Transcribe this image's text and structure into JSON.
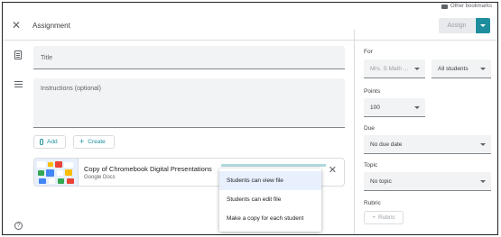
{
  "bookmarks": {
    "other_label": "Other bookmarks"
  },
  "header": {
    "title": "Assignment",
    "assign_label": "Assign"
  },
  "form": {
    "title_placeholder": "Title",
    "instructions_placeholder": "Instructions (optional)",
    "add_label": "Add",
    "create_label": "Create"
  },
  "attachment": {
    "title": "Copy of Chromebook Digital Presentations",
    "subtitle": "Google Docs"
  },
  "share_menu": {
    "items": [
      {
        "label": "Students can view file",
        "selected": true
      },
      {
        "label": "Students can edit file",
        "selected": false
      },
      {
        "label": "Make a copy for each student",
        "selected": false
      }
    ]
  },
  "sidebar": {
    "for_label": "For",
    "class_value": "Mrs. S Math ...",
    "students_value": "All students",
    "points_label": "Points",
    "points_value": "100",
    "due_label": "Due",
    "due_value": "No due date",
    "topic_label": "Topic",
    "topic_value": "No topic",
    "rubric_label": "Rubric",
    "rubric_button": "Rubric"
  },
  "colors": {
    "accent": "#1e8e9e",
    "menu_selected": "#e8f0fe"
  }
}
